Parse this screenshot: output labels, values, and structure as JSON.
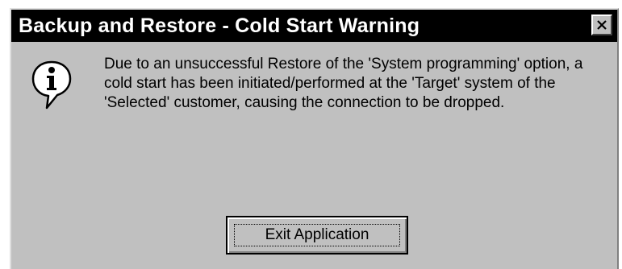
{
  "window": {
    "title": "Backup and Restore - Cold Start Warning",
    "close_icon": "close-icon"
  },
  "message": {
    "icon": "info-icon",
    "text": "Due to an unsuccessful Restore of the 'System programming' option, a cold start has been initiated/performed at the 'Target' system of the 'Selected' customer, causing the connection to be dropped."
  },
  "buttons": {
    "exit_label": "Exit Application"
  },
  "colors": {
    "titlebar": "#000000",
    "dialog_face": "#c0c0c0",
    "title_text": "#ffffff"
  }
}
